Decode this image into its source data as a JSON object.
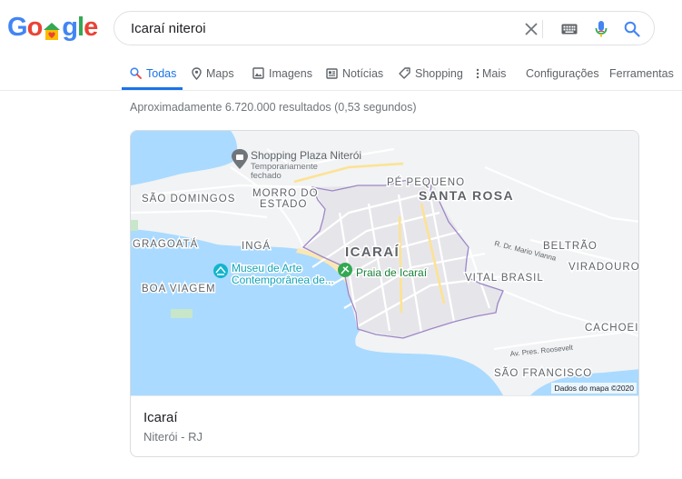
{
  "logo": {
    "letters": [
      "G",
      "o",
      "",
      "g",
      "l",
      "e"
    ]
  },
  "search": {
    "query": "Icaraí niteroi"
  },
  "tabs": [
    {
      "label": "Todas",
      "icon": "search-icon"
    },
    {
      "label": "Maps",
      "icon": "map-pin-icon"
    },
    {
      "label": "Imagens",
      "icon": "image-icon"
    },
    {
      "label": "Notícias",
      "icon": "news-icon"
    },
    {
      "label": "Shopping",
      "icon": "tag-icon"
    },
    {
      "label": "Mais",
      "icon": "more-vert-icon"
    },
    {
      "label": "Configurações",
      "icon": ""
    },
    {
      "label": "Ferramentas",
      "icon": ""
    }
  ],
  "results": {
    "count_text": "Aproximadamente 6.720.000 resultados (0,53 segundos)"
  },
  "map": {
    "labels": {
      "shopping_name": "Shopping Plaza Niterói",
      "shopping_status_1": "Temporariamente",
      "shopping_status_2": "fechado",
      "pe_pequeno": "PÉ PEQUENO",
      "santa_rosa": "SANTA ROSA",
      "sao_domingos": "SÃO DOMINGOS",
      "morro_do": "MORRO DO",
      "estado": "ESTADO",
      "gragoata": "GRAGOATÁ",
      "inga": "INGÁ",
      "icarai": "ICARAÍ",
      "museu_1": "Museu de Arte",
      "museu_2": "Contemporânea de...",
      "praia": "Praia de Icaraí",
      "rua_mario": "R. Dr. Mario Vianna",
      "beltrao": "BELTRÃO",
      "viradouro": "VIRADOURO",
      "vital_brasil": "VITAL BRASIL",
      "boa_viagem": "BOA VIAGEM",
      "cachoeira": "CACHOEIR",
      "av_roosevelt": "Av. Pres. Roosevelt",
      "sao_francisco": "SÃO FRANCISCO"
    },
    "credit": "Dados do mapa ©2020",
    "colors": {
      "water": "#aadaff",
      "land": "#f1f3f4",
      "park": "#c8e6c9",
      "beach": "#fbe7b4",
      "border": "#9e86c6"
    }
  },
  "place": {
    "title": "Icaraí",
    "subtitle": "Niterói - RJ"
  }
}
